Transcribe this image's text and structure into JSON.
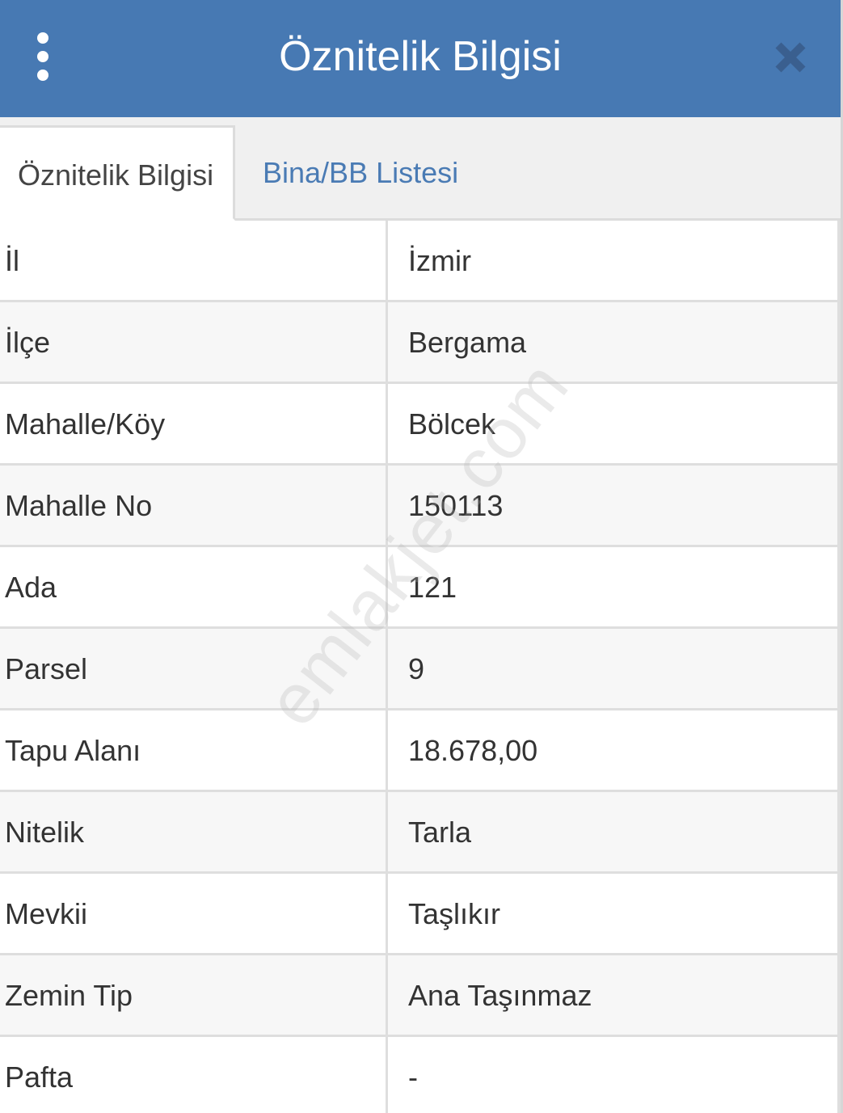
{
  "header": {
    "title": "Öznitelik Bilgisi",
    "menu_icon": "vertical-dots-icon",
    "close_icon": "close-icon"
  },
  "tabs": [
    {
      "label": "Öznitelik Bilgisi",
      "active": true
    },
    {
      "label": "Bina/BB Listesi",
      "active": false
    }
  ],
  "rows": [
    {
      "key": "İl",
      "value": "İzmir"
    },
    {
      "key": "İlçe",
      "value": "Bergama"
    },
    {
      "key": "Mahalle/Köy",
      "value": "Bölcek"
    },
    {
      "key": "Mahalle No",
      "value": "150113"
    },
    {
      "key": "Ada",
      "value": "121"
    },
    {
      "key": "Parsel",
      "value": "9"
    },
    {
      "key": "Tapu Alanı",
      "value": "18.678,00"
    },
    {
      "key": "Nitelik",
      "value": "Tarla"
    },
    {
      "key": "Mevkii",
      "value": "Taşlıkır"
    },
    {
      "key": "Zemin Tip",
      "value": "Ana Taşınmaz"
    },
    {
      "key": "Pafta",
      "value": "-"
    }
  ],
  "watermark": "emlakjet.com",
  "colors": {
    "header_bg": "#4779b3",
    "tab_link": "#4a7bb4",
    "close_icon": "#3a5f8f"
  }
}
